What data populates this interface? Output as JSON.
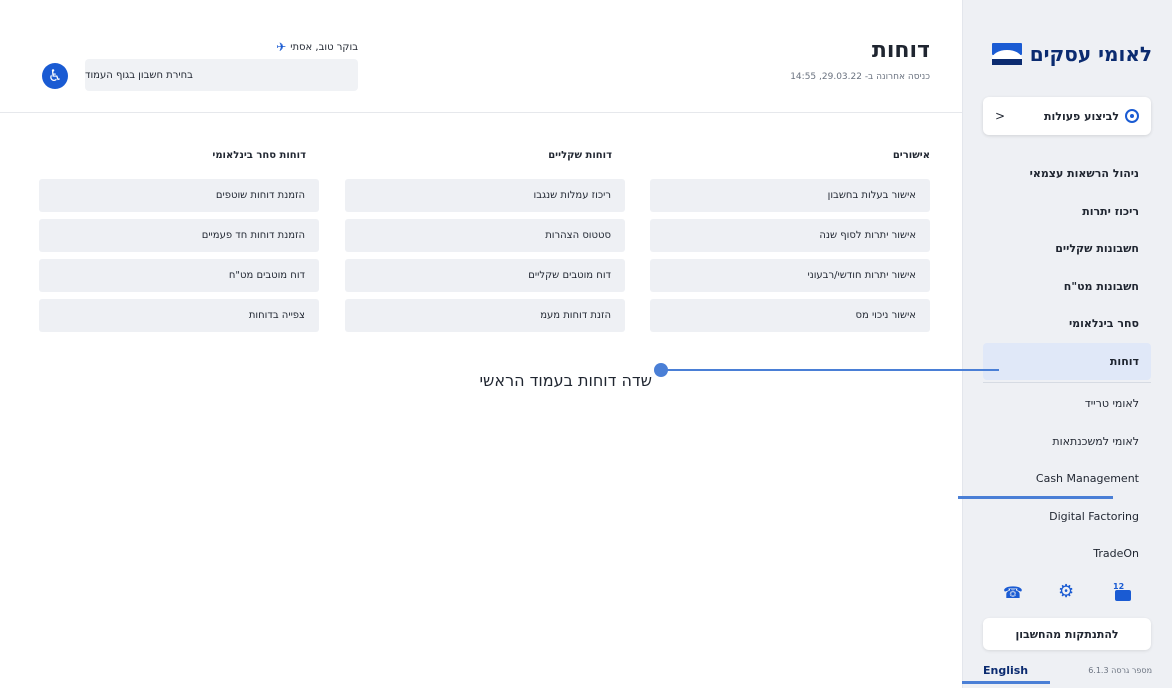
{
  "sidebar": {
    "brand": "לאומי עסקים",
    "actions_label": "לביצוע פעולות",
    "actions_chevron": "<",
    "items": [
      {
        "label": "ניהול הרשאות עצמאי"
      },
      {
        "label": "ריכוז יתרות"
      },
      {
        "label": "חשבונות שקליים"
      },
      {
        "label": "חשבונות מט\"ח"
      },
      {
        "label": "סחר בינלאומי"
      },
      {
        "label": "דוחות"
      },
      {
        "label": "לאומי טרייד"
      },
      {
        "label": "לאומי למשכנתאות"
      },
      {
        "label": "Cash Management"
      },
      {
        "label": "Digital Factoring"
      },
      {
        "label": "TradeOn"
      }
    ],
    "mail_badge": "12",
    "logout_label": "להתנתקות מהחשבון",
    "language_label": "English",
    "version_text": "מספר גרסה 6.1.3",
    "accent_color": "#1a5bd3",
    "brand_color": "#0b2b70"
  },
  "header": {
    "title": "דוחות",
    "last_login": "כניסה אחרונה ב- 29.03.22, 14:55",
    "greeting": "בוקר טוב, אסתי",
    "account_select_placeholder": "בחירת חשבון בגוף העמוד"
  },
  "columns": [
    {
      "title": "אישורים",
      "items": [
        "אישור בעלות בחשבון",
        "אישור יתרות לסוף שנה",
        "אישור יתרות חודשי/רבעוני",
        "אישור ניכוי מס"
      ]
    },
    {
      "title": "דוחות שקליים",
      "items": [
        "ריכוז עמלות שנגבו",
        "סטטוס הצהרות",
        "דוח מוטבים שקליים",
        "הזנת דוחות מעמ"
      ]
    },
    {
      "title": "דוחות סחר בינלאומי",
      "items": [
        "הזמנת דוחות שוטפים",
        "הזמנת דוחות חד פעמיים",
        "דוח מוטבים מט\"ח",
        "צפייה בדוחות"
      ]
    }
  ],
  "annotation": {
    "text": "שדה דוחות בעמוד הראשי"
  }
}
